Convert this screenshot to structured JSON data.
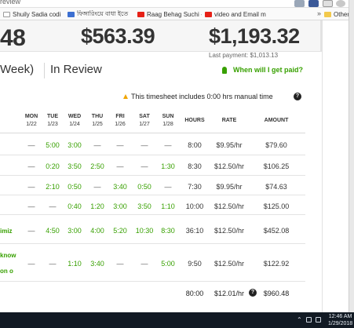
{
  "browser": {
    "url_text": "review",
    "bookmarks": [
      {
        "label": "Shuily Sadia coding",
        "icon": "page-icon"
      },
      {
        "label": "ফিঙ্গারিংয়ে বাধা ইতে",
        "icon": "bookmark-icon"
      },
      {
        "label": "Raag Behag Suchi - Y",
        "icon": "youtube-icon"
      },
      {
        "label": "video and Email mar",
        "icon": "youtube-icon"
      }
    ],
    "more_label": "»",
    "other_bookmarks": "Other bo"
  },
  "earnings": {
    "amount_1": "48",
    "amount_2": "$563.39",
    "amount_3": "$1,193.32",
    "last_payment": "Last payment: $1,013.13"
  },
  "timesheet": {
    "title_left": "Week)",
    "title_right": "In Review",
    "paid_link": "When will I get paid?",
    "manual_note": "This timesheet includes 0:00 hrs manual time",
    "help_glyph": "?",
    "headers": {
      "days": [
        {
          "day": "MON",
          "date": "1/22"
        },
        {
          "day": "TUE",
          "date": "1/23"
        },
        {
          "day": "WED",
          "date": "1/24"
        },
        {
          "day": "THU",
          "date": "1/25"
        },
        {
          "day": "FRI",
          "date": "1/26"
        },
        {
          "day": "SAT",
          "date": "1/27"
        },
        {
          "day": "SUN",
          "date": "1/28"
        }
      ],
      "hours": "HOURS",
      "rate": "RATE",
      "amount": "AMOUNT"
    },
    "rows": [
      {
        "desc": [],
        "days": [
          "—",
          "5:00",
          "3:00",
          "—",
          "—",
          "—",
          "—"
        ],
        "hours": "8:00",
        "rate": "$9.95/hr",
        "amount": "$79.60"
      },
      {
        "desc": [],
        "days": [
          "—",
          "0:20",
          "3:50",
          "2:50",
          "—",
          "—",
          "1:30"
        ],
        "hours": "8:30",
        "rate": "$12.50/hr",
        "amount": "$106.25"
      },
      {
        "desc": [],
        "days": [
          "—",
          "2:10",
          "0:50",
          "—",
          "3:40",
          "0:50",
          "—"
        ],
        "hours": "7:30",
        "rate": "$9.95/hr",
        "amount": "$74.63"
      },
      {
        "desc": [],
        "days": [
          "—",
          "—",
          "0:40",
          "1:20",
          "3:00",
          "3:50",
          "1:10"
        ],
        "hours": "10:00",
        "rate": "$12.50/hr",
        "amount": "$125.00"
      },
      {
        "desc": [
          "imiz"
        ],
        "days": [
          "—",
          "4:50",
          "3:00",
          "4:00",
          "5:20",
          "10:30",
          "8:30"
        ],
        "hours": "36:10",
        "rate": "$12.50/hr",
        "amount": "$452.08"
      },
      {
        "desc": [
          "know",
          "on o"
        ],
        "days": [
          "—",
          "—",
          "1:10",
          "3:40",
          "—",
          "—",
          "5:00"
        ],
        "hours": "9:50",
        "rate": "$12.50/hr",
        "amount": "$122.92"
      }
    ],
    "summary": {
      "hours": "80:00",
      "rate": "$12.01/hr",
      "amount": "$960.48"
    }
  },
  "taskbar": {
    "time": "12:46 AM",
    "date": "1/29/2018"
  },
  "colors": {
    "accent_green": "#37a000",
    "taskbar": "#121a24"
  }
}
